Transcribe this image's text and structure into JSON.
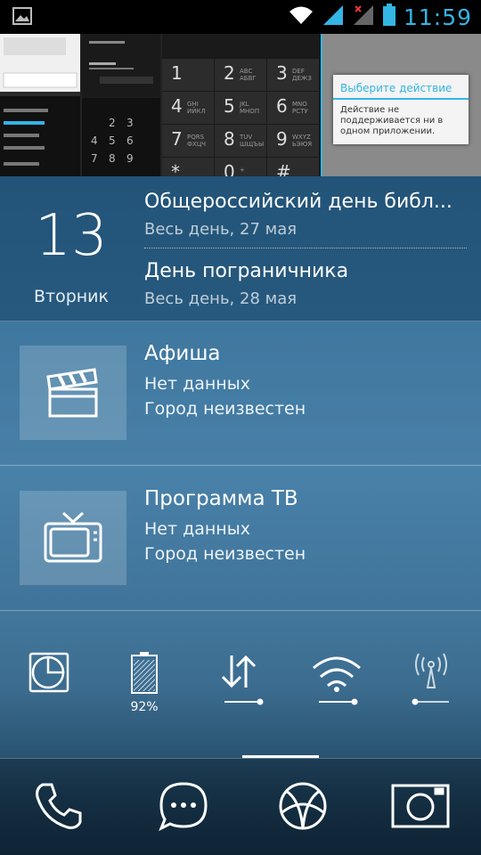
{
  "status_bar": {
    "time": "11:59",
    "icons": [
      "image-icon",
      "wifi-icon",
      "signal-icon",
      "no-signal-icon",
      "battery-icon"
    ]
  },
  "recents": {
    "keypad": [
      {
        "digit": "1",
        "letters": ""
      },
      {
        "digit": "2",
        "letters": "ABC АБВГ"
      },
      {
        "digit": "3",
        "letters": "DEF ДЕЖЗ"
      },
      {
        "digit": "4",
        "letters": "GHI ИЙКЛ"
      },
      {
        "digit": "5",
        "letters": "JKL МНОП"
      },
      {
        "digit": "6",
        "letters": "MNO РСТУ"
      },
      {
        "digit": "7",
        "letters": "PQRS ФХЦЧ"
      },
      {
        "digit": "8",
        "letters": "TUV ШЩЪЫ"
      },
      {
        "digit": "9",
        "letters": "WXYZ ЬЭЮЯ"
      },
      {
        "digit": "*",
        "letters": ""
      },
      {
        "digit": "0",
        "letters": "+"
      },
      {
        "digit": "#",
        "letters": ""
      }
    ],
    "dialog_title": "Выберите действие",
    "dialog_text": "Действие не поддерживается ни в одном приложении."
  },
  "calendar": {
    "day": "13",
    "weekday": "Вторник",
    "events": [
      {
        "title": "Общероссийский день библ...",
        "subtitle": "Весь день, 27 мая"
      },
      {
        "title": "День пограничника",
        "subtitle": "Весь день, 28 мая"
      }
    ]
  },
  "afisha": {
    "title": "Афиша",
    "line1": "Нет данных",
    "line2": "Город неизвестен",
    "icon": "clapperboard-icon"
  },
  "tv": {
    "title": "Программа ТВ",
    "line1": "Нет данных",
    "line2": "Город неизвестен",
    "icon": "tv-icon"
  },
  "quick_settings": {
    "battery_label": "92%",
    "battery_level": 0.92,
    "icons": [
      "rotation-icon",
      "battery-icon",
      "data-transfer-icon",
      "wifi-icon",
      "hotspot-icon"
    ]
  },
  "dock": {
    "icons": [
      "phone-icon",
      "messages-icon",
      "browser-icon",
      "camera-icon"
    ]
  },
  "colors": {
    "accent": "#33b5e5"
  }
}
